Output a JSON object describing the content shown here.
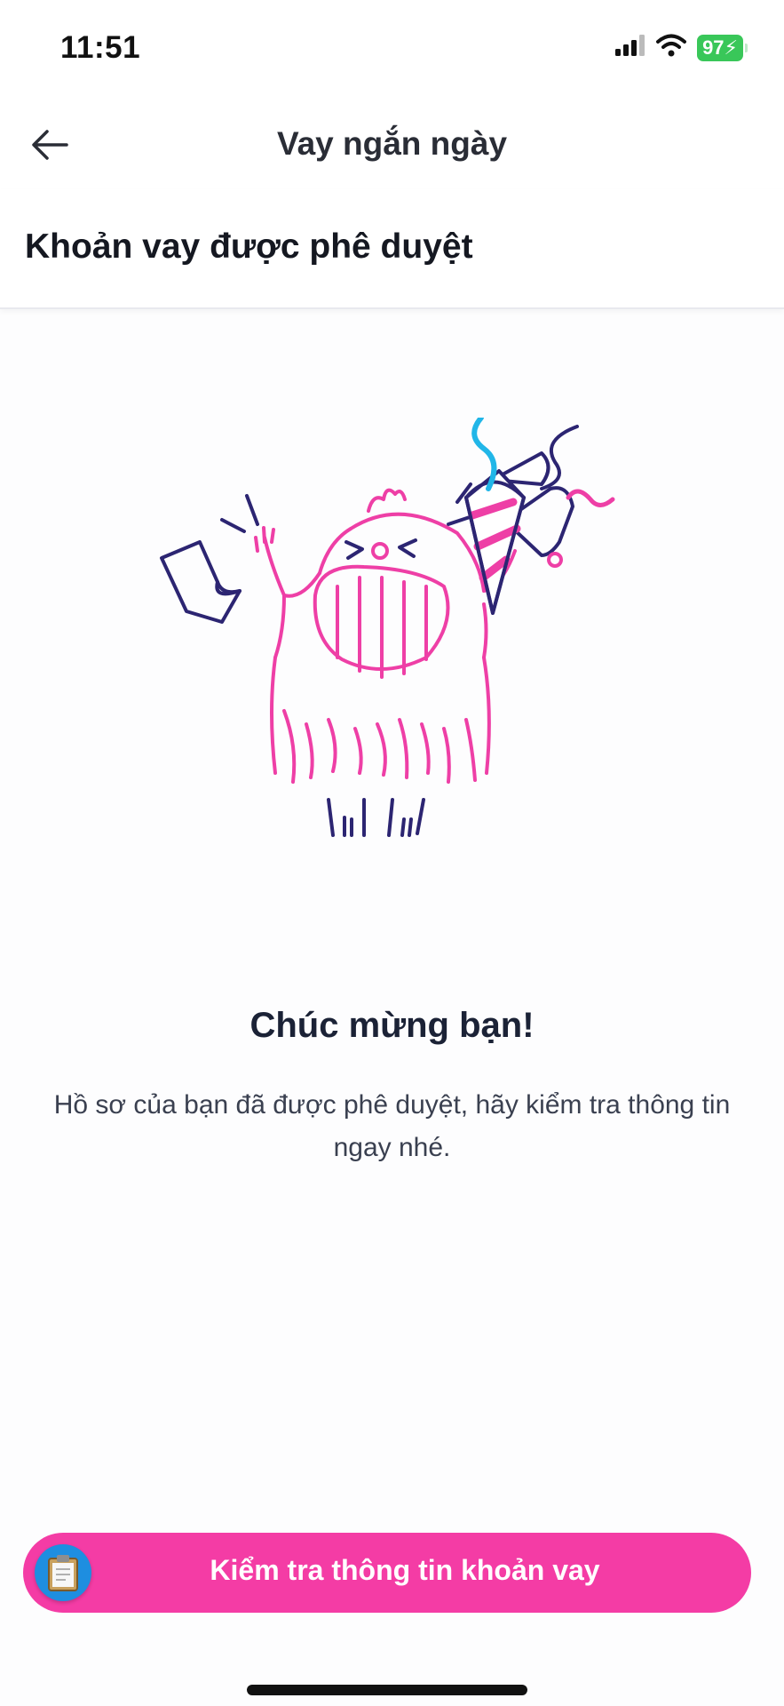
{
  "status_bar": {
    "time": "11:51",
    "battery": "97",
    "icons": [
      "cellular-signal-icon",
      "wifi-icon",
      "battery-charging-icon"
    ]
  },
  "nav": {
    "title": "Vay ngắn ngày",
    "back_icon": "arrow-left-icon"
  },
  "section": {
    "title": "Khoản vay được phê duyệt"
  },
  "content": {
    "headline": "Chúc mừng bạn!",
    "message": "Hồ sơ của bạn đã được phê duyệt, hãy kiểm tra thông tin ngay nhé."
  },
  "cta": {
    "label": "Kiểm tra thông tin khoản vay",
    "icon": "clipboard-icon"
  },
  "colors": {
    "accent": "#f43ca5",
    "illustration_pink": "#ee3fa6",
    "illustration_navy": "#2c2572",
    "illustration_cyan": "#21b6e8",
    "battery": "#39c759"
  }
}
